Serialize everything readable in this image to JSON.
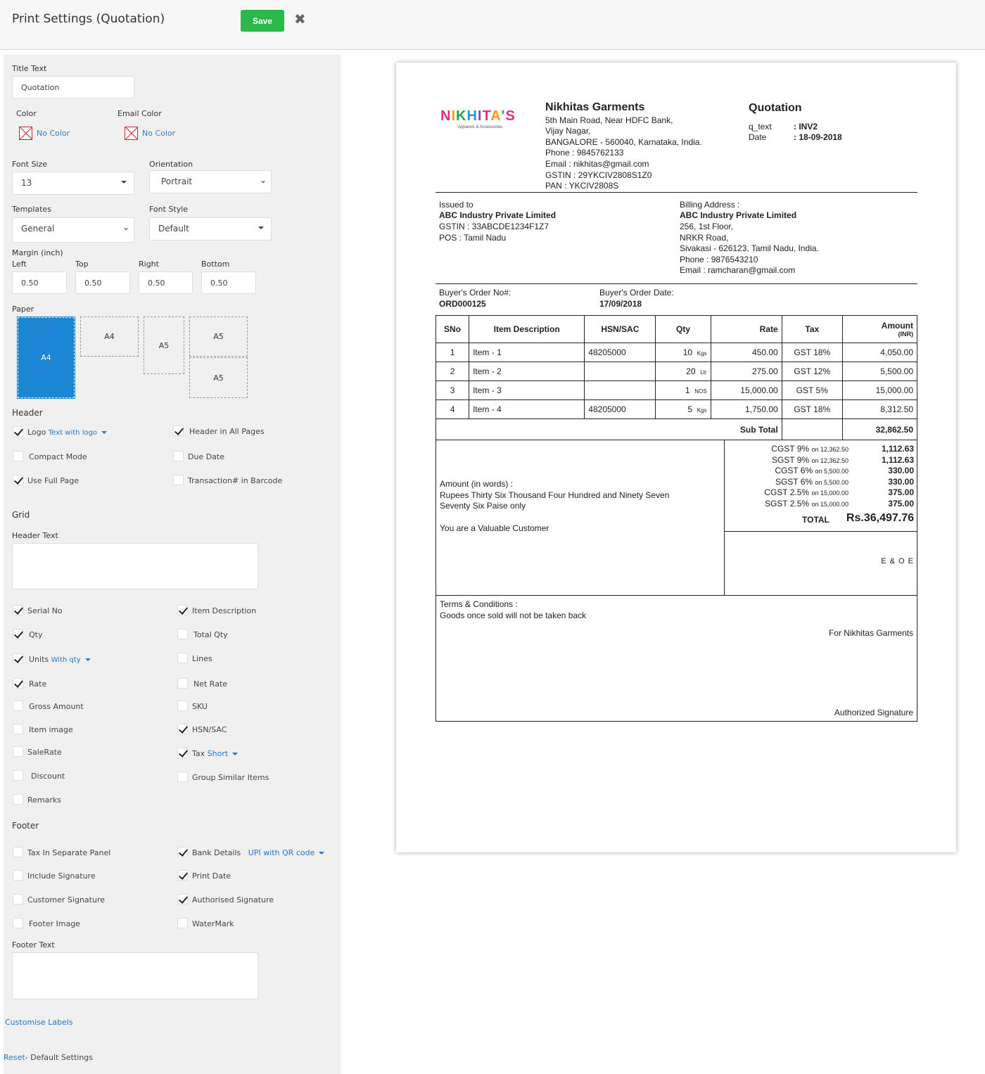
{
  "header": {
    "title": "Print Settings (Quotation)",
    "save_label": "Save",
    "close_glyph": "✖"
  },
  "settings": {
    "title_text_label": "Title Text",
    "title_text_value": "Quotation",
    "color_label": "Color",
    "email_color_label": "Email Color",
    "no_color": "No Color",
    "font_size_label": "Font Size",
    "font_size_value": "13",
    "orientation_label": "Orientation",
    "orientation_value": "Portrait",
    "templates_label": "Templates",
    "templates_value": "General",
    "font_style_label": "Font Style",
    "font_style_value": "Default",
    "margin_label": "Margin (inch)",
    "margins": [
      {
        "label": "Left",
        "value": "0.50"
      },
      {
        "label": "Top",
        "value": "0.50"
      },
      {
        "label": "Right",
        "value": "0.50"
      },
      {
        "label": "Bottom",
        "value": "0.50"
      }
    ],
    "paper_label": "Paper",
    "papers": [
      "A4",
      "A4",
      "A5",
      "A5",
      "A5"
    ],
    "header_section": "Header",
    "header_options": [
      {
        "label": "Logo",
        "checked": true,
        "extra": "Text with logo"
      },
      {
        "label": "Header in All Pages",
        "checked": true
      },
      {
        "label": "Compact Mode",
        "checked": false
      },
      {
        "label": "Due Date",
        "checked": false
      },
      {
        "label": "Use Full Page",
        "checked": true
      },
      {
        "label": "Transaction# in Barcode",
        "checked": false
      }
    ],
    "grid_section": "Grid",
    "header_text_label": "Header Text",
    "grid_options": [
      {
        "label": "Serial No",
        "checked": true
      },
      {
        "label": "Item Description",
        "checked": true
      },
      {
        "label": "Qty",
        "checked": true
      },
      {
        "label": "Total Qty",
        "checked": false
      },
      {
        "label": "Units",
        "checked": true,
        "extra": "With qty"
      },
      {
        "label": "Lines",
        "checked": false
      },
      {
        "label": "Rate",
        "checked": true
      },
      {
        "label": "Net Rate",
        "checked": false
      },
      {
        "label": "Gross Amount",
        "checked": false
      },
      {
        "label": "SKU",
        "checked": false
      },
      {
        "label": "Item image",
        "checked": false
      },
      {
        "label": "HSN/SAC",
        "checked": true
      },
      {
        "label": "SaleRate",
        "checked": false
      },
      {
        "label": "Tax",
        "checked": true,
        "extra": "Short"
      },
      {
        "label": "Discount",
        "checked": false
      },
      {
        "label": "Group Similar Items",
        "checked": false
      },
      {
        "label": "Remarks",
        "checked": false
      }
    ],
    "footer_section": "Footer",
    "footer_options": [
      {
        "label": "Tax In Separate Panel",
        "checked": false
      },
      {
        "label": "Bank Details",
        "checked": true,
        "extra": "UPI with QR code"
      },
      {
        "label": "Include Signature",
        "checked": false
      },
      {
        "label": "Print Date",
        "checked": true
      },
      {
        "label": "Customer Signature",
        "checked": false
      },
      {
        "label": "Authorised Signature",
        "checked": true
      },
      {
        "label": "Footer Image",
        "checked": false
      },
      {
        "label": "WaterMark",
        "checked": false
      }
    ],
    "footer_text_label": "Footer Text",
    "customise_labels": "Customise Labels",
    "reset_link": "Reset",
    "reset_rest": "- Default Settings"
  },
  "doc": {
    "logo_text": "NIKHITA'S",
    "logo_tagline": "Apparels & Accessories",
    "company_name": "Nikhitas Garments",
    "company_lines": [
      "5th Main Road, Near HDFC Bank,",
      "Vijay Nagar,",
      "BANGALORE - 560040, Karnataka, India.",
      "Phone : 9845762133",
      "Email : nikhitas@gmail.com",
      "GSTIN : 29YKCIV2808S1Z0",
      "PAN : YKCIV2808S"
    ],
    "doc_title": "Quotation",
    "qtext_label": "q_text",
    "qtext_value": ": INV2",
    "date_label": "Date",
    "date_value": ": 18-09-2018",
    "issued_to_label": "Issued to",
    "issued_name": "ABC Industry Private Limited",
    "issued_gstin": "GSTIN : 33ABCDE1234F1Z7",
    "issued_pos": "POS : Tamil Nadu",
    "billing_label": "Billing Address :",
    "billing_name": "ABC Industry Private Limited",
    "billing_lines": [
      "256, 1st Floor,",
      "NRKR Road,",
      "Sivakasi - 626123, Tamil Nadu, India.",
      "Phone : 9876543210",
      "Email : ramcharan@gmail.com"
    ],
    "order_no_label": "Buyer's Order No#:",
    "order_no": "ORD000125",
    "order_date_label": "Buyer's Order Date:",
    "order_date": "17/09/2018",
    "columns": [
      "SNo",
      "Item Description",
      "HSN/SAC",
      "Qty",
      "Rate",
      "Tax",
      "Amount",
      "(INR)"
    ],
    "rows": [
      {
        "sno": "1",
        "desc": "Item - 1",
        "hsn": "48205000",
        "qty": "10",
        "unit": "Kgs",
        "rate": "450.00",
        "tax": "GST 18%",
        "amount": "4,050.00"
      },
      {
        "sno": "2",
        "desc": "Item - 2",
        "hsn": "",
        "qty": "20",
        "unit": "Ltr",
        "rate": "275.00",
        "tax": "GST 12%",
        "amount": "5,500.00"
      },
      {
        "sno": "3",
        "desc": "Item - 3",
        "hsn": "",
        "qty": "1",
        "unit": "NOS",
        "rate": "15,000.00",
        "tax": "GST 5%",
        "amount": "15,000.00"
      },
      {
        "sno": "4",
        "desc": "Item - 4",
        "hsn": "48205000",
        "qty": "5",
        "unit": "Kgs",
        "rate": "1,750.00",
        "tax": "GST 18%",
        "amount": "8,312.50"
      }
    ],
    "subtotal_label": "Sub Total",
    "subtotal": "32,862.50",
    "amount_words_label": "Amount (in words) :",
    "amount_words_1": "Rupees Thirty Six Thousand Four Hundred and Ninety Seven",
    "amount_words_2": "Seventy Six Paise only",
    "valuable": "You are a Valuable Customer",
    "taxes": [
      {
        "name": "CGST 9%",
        "on": "on 12,362.50",
        "value": "1,112.63"
      },
      {
        "name": "SGST 9%",
        "on": "on 12,362.50",
        "value": "1,112.63"
      },
      {
        "name": "CGST 6%",
        "on": "on 5,500.00",
        "value": "330.00"
      },
      {
        "name": "SGST 6%",
        "on": "on 5,500.00",
        "value": "330.00"
      },
      {
        "name": "CGST 2.5%",
        "on": "on 15,000.00",
        "value": "375.00"
      },
      {
        "name": "SGST 2.5%",
        "on": "on 15,000.00",
        "value": "375.00"
      }
    ],
    "total_label": "TOTAL",
    "total_value": "Rs.36,497.76",
    "eoe": "E & O E",
    "terms_label": "Terms & Conditions :",
    "terms_text": "Goods once sold will not be taken back",
    "for_company": "For Nikhitas Garments",
    "auth_signature": "Authorized Signature"
  }
}
